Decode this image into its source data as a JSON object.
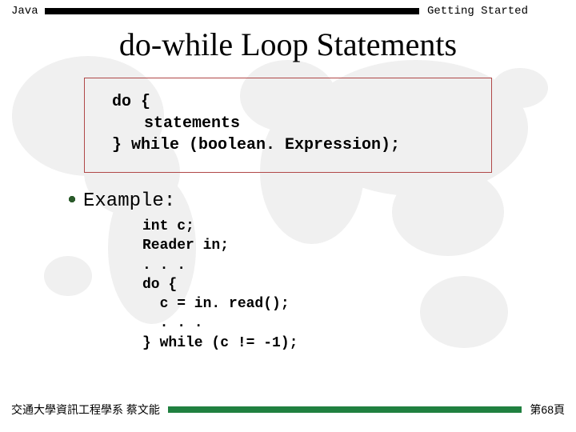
{
  "header": {
    "left": "Java",
    "right": "Getting Started"
  },
  "title": "do-while Loop Statements",
  "syntax": {
    "line1": "do {",
    "line2": "statements",
    "line3": "} while (boolean. Expression);"
  },
  "example_label": "Example:",
  "example_code": "int c;\nReader in;\n. . .\ndo {\n  c = in. read();\n  . . .\n} while (c != -1);",
  "footer": {
    "left": "交通大學資訊工程學系 蔡文能",
    "right": "第68頁"
  }
}
